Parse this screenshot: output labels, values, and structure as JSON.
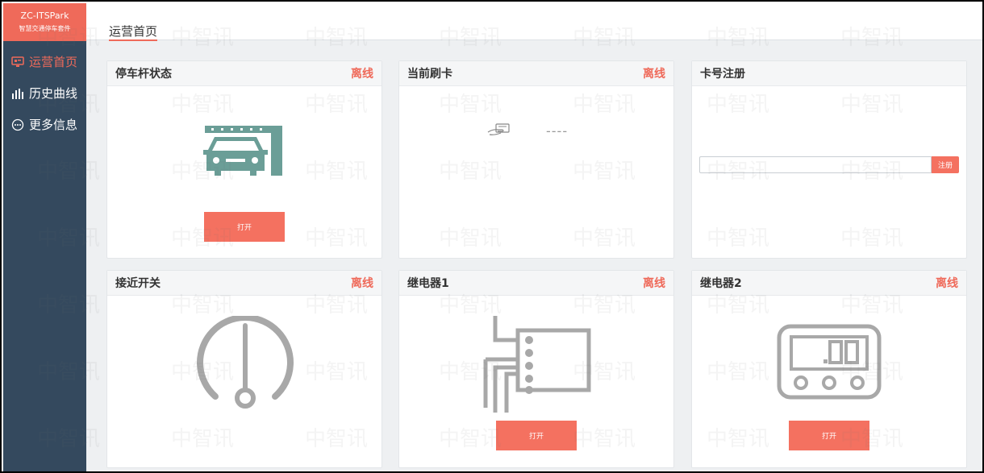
{
  "brand": {
    "title": "ZC-ITSPark",
    "subtitle": "智慧交通停车套件"
  },
  "sidebar": {
    "items": [
      {
        "label": "运营首页",
        "icon": "monitor-icon",
        "active": true
      },
      {
        "label": "历史曲线",
        "icon": "bar-chart-icon",
        "active": false
      },
      {
        "label": "更多信息",
        "icon": "more-dots-icon",
        "active": false
      }
    ]
  },
  "header": {
    "title": "运营首页"
  },
  "cards": {
    "barrier": {
      "title": "停车杆状态",
      "status": "离线",
      "button": "打开",
      "icon": "car-barrier-icon"
    },
    "card_swipe": {
      "title": "当前刷卡",
      "status": "离线",
      "value": "----",
      "icon": "hand-card-icon"
    },
    "card_register": {
      "title": "卡号注册",
      "input_value": "",
      "placeholder": "",
      "button": "注册"
    },
    "proximity": {
      "title": "接近开关",
      "status": "离线",
      "icon": "gauge-icon"
    },
    "relay1": {
      "title": "继电器1",
      "status": "离线",
      "button": "打开",
      "icon": "relay-icon"
    },
    "relay2": {
      "title": "继电器2",
      "status": "离线",
      "button": "打开",
      "icon": "meter-icon",
      "display": ".00"
    }
  },
  "watermark": "中智讯",
  "colors": {
    "accent": "#ef6a5a",
    "button": "#f47160",
    "sidebar": "#34495e",
    "icon_teal": "#6b9e97",
    "icon_gray": "#a8a8a8"
  }
}
